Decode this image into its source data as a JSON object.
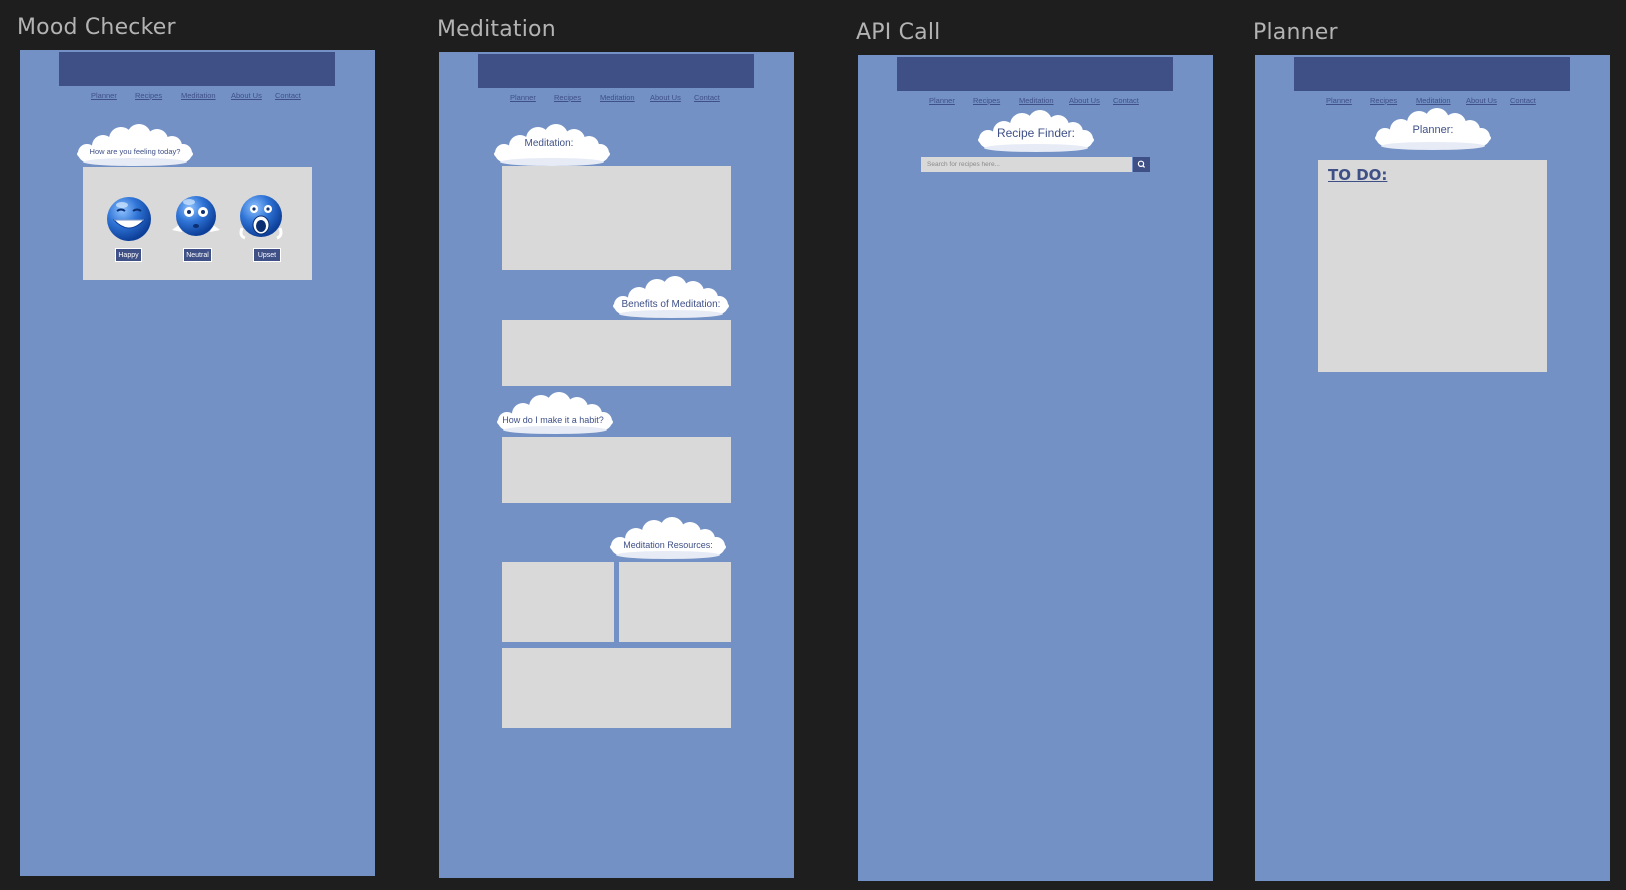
{
  "nav_links": [
    "Planner",
    "Recipes",
    "Meditation",
    "About Us",
    "Contact"
  ],
  "colors": {
    "canvas": "#1e1e1e",
    "frame_bg": "#7391c5",
    "header": "#3f5087",
    "panel": "#d9d9d9",
    "frame_title": "#b3b3b3"
  },
  "mood_checker": {
    "frame_title": "Mood Checker",
    "cloud_label": "How are you feeling today?",
    "moods": [
      {
        "label": "Happy",
        "icon": "grinning-face-icon"
      },
      {
        "label": "Neutral",
        "icon": "shrugging-face-icon"
      },
      {
        "label": "Upset",
        "icon": "screaming-face-icon"
      }
    ]
  },
  "meditation": {
    "frame_title": "Meditation",
    "cloud_main": "Meditation:",
    "cloud_benefits": "Benefits of Meditation:",
    "cloud_habit": "How do I make it a habit?",
    "cloud_resources": "Meditation Resources:"
  },
  "api_call": {
    "frame_title": "API Call",
    "cloud_label": "Recipe Finder:",
    "search_placeholder": "Search for recipes here...",
    "search_icon": "search-icon"
  },
  "planner": {
    "frame_title": "Planner",
    "cloud_label": "Planner:",
    "todo_title": "TO DO:"
  }
}
